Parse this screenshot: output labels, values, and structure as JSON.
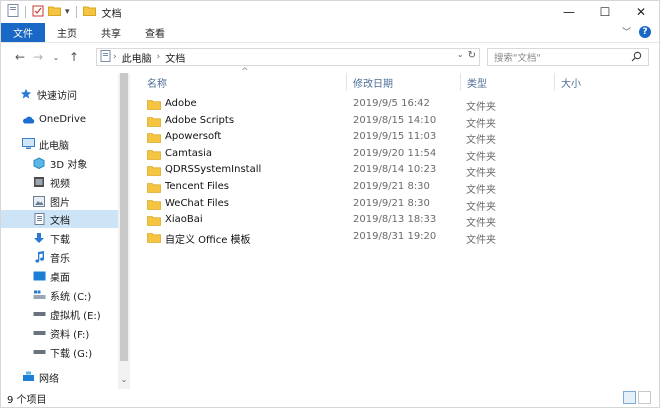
{
  "window": {
    "title": "文档"
  },
  "ribbon": {
    "tabs": [
      "文件",
      "主页",
      "共享",
      "查看"
    ]
  },
  "address": {
    "crumbs": [
      "此电脑",
      "文档"
    ]
  },
  "search": {
    "placeholder": "搜索\"文档\""
  },
  "columns": {
    "name": "名称",
    "modified": "修改日期",
    "type": "类型",
    "size": "大小"
  },
  "sidebar": {
    "items": [
      {
        "label": "快速访问",
        "icon": "star-icon"
      },
      {
        "label": "OneDrive",
        "icon": "cloud-icon"
      },
      {
        "label": "此电脑",
        "icon": "computer-icon"
      },
      {
        "label": "3D 对象",
        "icon": "cube-icon"
      },
      {
        "label": "视频",
        "icon": "video-icon"
      },
      {
        "label": "图片",
        "icon": "picture-icon"
      },
      {
        "label": "文档",
        "icon": "document-icon"
      },
      {
        "label": "下载",
        "icon": "download-icon"
      },
      {
        "label": "音乐",
        "icon": "music-icon"
      },
      {
        "label": "桌面",
        "icon": "desktop-icon"
      },
      {
        "label": "系统 (C:)",
        "icon": "drive-c-icon"
      },
      {
        "label": "虚拟机 (E:)",
        "icon": "drive-icon"
      },
      {
        "label": "资料 (F:)",
        "icon": "drive-icon"
      },
      {
        "label": "下载 (G:)",
        "icon": "drive-icon"
      },
      {
        "label": "网络",
        "icon": "network-icon"
      }
    ]
  },
  "files": [
    {
      "name": "Adobe",
      "date": "2019/9/5 16:42",
      "type": "文件夹"
    },
    {
      "name": "Adobe Scripts",
      "date": "2019/8/15 14:10",
      "type": "文件夹"
    },
    {
      "name": "Apowersoft",
      "date": "2019/9/15 11:03",
      "type": "文件夹"
    },
    {
      "name": "Camtasia",
      "date": "2019/9/20 11:54",
      "type": "文件夹"
    },
    {
      "name": "QDRSSystemInstall",
      "date": "2019/8/14 10:23",
      "type": "文件夹"
    },
    {
      "name": "Tencent Files",
      "date": "2019/9/21 8:30",
      "type": "文件夹"
    },
    {
      "name": "WeChat Files",
      "date": "2019/9/21 8:30",
      "type": "文件夹"
    },
    {
      "name": "XiaoBai",
      "date": "2019/8/13 18:33",
      "type": "文件夹"
    },
    {
      "name": "自定义 Office 模板",
      "date": "2019/8/31 19:20",
      "type": "文件夹"
    }
  ],
  "status": {
    "count": "9 个项目"
  },
  "colors": {
    "accent": "#1a68c5",
    "folder": "#f5c542",
    "selected": "#cde4f7"
  }
}
